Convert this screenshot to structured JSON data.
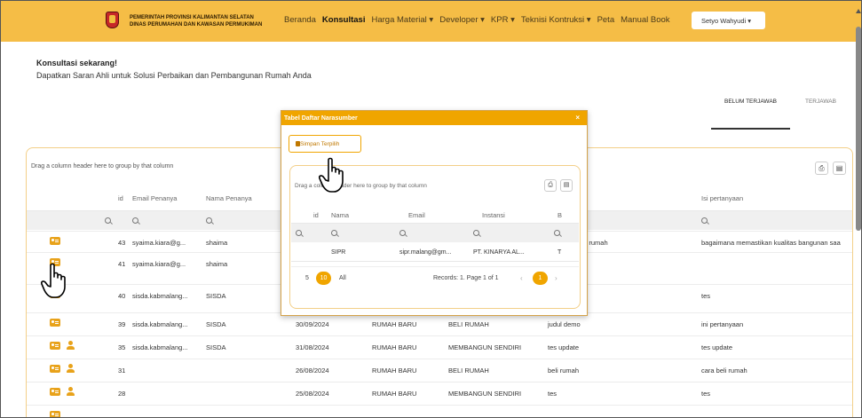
{
  "navbar": {
    "org_line1": "PEMERINTAH PROVINSI KALIMANTAN SELATAN",
    "org_line2": "DINAS PERUMAHAN DAN KAWASAN PERMUKIMAN",
    "menu": [
      "Beranda",
      "Konsultasi",
      "Harga Material ▾",
      "Developer ▾",
      "KPR ▾",
      "Teknisi Kontruksi ▾",
      "Peta",
      "Manual Book"
    ],
    "active_menu": "Konsultasi",
    "user_label": "Setyo Wahyudi ▾"
  },
  "hero": {
    "title": "Konsultasi sekarang!",
    "subtitle": "Dapatkan Saran Ahli untuk Solusi Perbaikan dan Pembangunan Rumah Anda"
  },
  "tabs": [
    "BELUM TERJAWAB",
    "TERJAWAB"
  ],
  "grid": {
    "group_hint": "Drag a column header here to group by that column",
    "columns": [
      "id",
      "Email Penanya",
      "Nama Penanya",
      "Isi pertanyaan"
    ],
    "rows": [
      {
        "id": "43",
        "email": "syaima.kiara@g...",
        "nama": "shaima",
        "tanggal": "",
        "kategori": "",
        "jenis": "",
        "judul": "...bangun rumah",
        "isi": "bagaimana memastikan kualitas bangunan saa"
      },
      {
        "id": "41",
        "email": "syaima.kiara@g...",
        "nama": "shaima",
        "tanggal": "",
        "kategori": "",
        "jenis": "",
        "judul": "",
        "isi": ""
      },
      {
        "id": "40",
        "email": "sisda.kabmalang...",
        "nama": "SISDA",
        "tanggal": "",
        "kategori": "",
        "jenis": "",
        "judul": "",
        "isi": "tes"
      },
      {
        "id": "39",
        "email": "sisda.kabmalang...",
        "nama": "SISDA",
        "tanggal": "30/09/2024",
        "kategori": "RUMAH BARU",
        "jenis": "BELI RUMAH",
        "judul": "judul demo",
        "isi": "ini pertanyaan"
      },
      {
        "id": "35",
        "email": "sisda.kabmalang...",
        "nama": "SISDA",
        "tanggal": "31/08/2024",
        "kategori": "RUMAH BARU",
        "jenis": "MEMBANGUN SENDIRI",
        "judul": "tes update",
        "isi": "tes update"
      },
      {
        "id": "31",
        "email": "",
        "nama": "",
        "tanggal": "26/08/2024",
        "kategori": "RUMAH BARU",
        "jenis": "BELI RUMAH",
        "judul": "beli rumah",
        "isi": "cara beli rumah"
      },
      {
        "id": "28",
        "email": "",
        "nama": "",
        "tanggal": "25/08/2024",
        "kategori": "RUMAH BARU",
        "jenis": "MEMBANGUN SENDIRI",
        "judul": "tes",
        "isi": "tes"
      }
    ]
  },
  "modal": {
    "title": "Tabel Daftar Narasumber",
    "close": "×",
    "save_label": "Simpan Terpilih",
    "group_hint": "Drag a column header here to group by that column",
    "columns": [
      "id",
      "Nama",
      "Email",
      "Instansi",
      "B"
    ],
    "row": {
      "nama": "SIPR",
      "email": "sipr.malang@gm...",
      "instansi": "PT. KINARYA AL...",
      "b": "T"
    },
    "pager": {
      "sizes": [
        "5",
        "10",
        "All"
      ],
      "selected_size": "10",
      "info": "Records: 1. Page 1 of 1",
      "page": "1"
    }
  },
  "colors": {
    "navbar": "#f5bd46",
    "accent": "#f0a500",
    "icon": "#e8a21a"
  }
}
